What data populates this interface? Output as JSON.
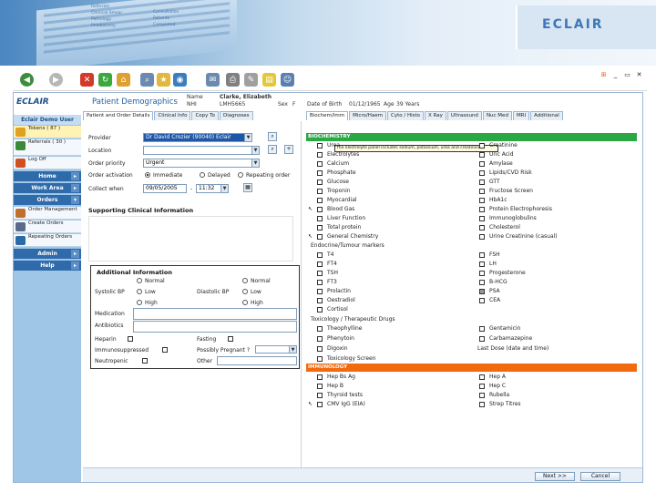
{
  "banner": {
    "brand": "ECLAIR",
    "bg_text": [
      "Referrals",
      "Cervical Smear",
      "Pathology",
      "Phlebotomy",
      "Consultation",
      "Patients",
      "Completed"
    ],
    "accent": "#3f78b6"
  },
  "app": {
    "logo": "ECLAIR",
    "user": "Eclair Demo User"
  },
  "sidebar": {
    "items": [
      {
        "label": "Tokens ( 87 )",
        "icon": "tokens-icon"
      },
      {
        "label": "Referrals ( 30 )",
        "icon": "referrals-icon"
      },
      {
        "label": "Log Off",
        "icon": "log-off-icon"
      }
    ],
    "sections": [
      {
        "label": "Home"
      },
      {
        "label": "Work Area"
      },
      {
        "label": "Orders"
      }
    ],
    "order_items": [
      {
        "label": "Order Management",
        "icon": "order-management-icon"
      },
      {
        "label": "Create Orders",
        "icon": "create-orders-icon"
      },
      {
        "label": "Repeating Orders",
        "icon": "repeating-orders-icon"
      }
    ],
    "bottom_sections": [
      {
        "label": "Admin"
      },
      {
        "label": "Help"
      }
    ]
  },
  "header": {
    "title": "Patient Demographics",
    "name_label": "Name",
    "name_value": "Clarke, Elizabeth",
    "nhi_label": "NHI",
    "nhi_value": "LMH5665",
    "sex_label": "Sex",
    "sex_value": "F",
    "dob_label": "Date of Birth",
    "dob_value": "01/12/1965",
    "age_label": "Age",
    "age_value": "39 Years"
  },
  "left_tabs": [
    "Patient and Order Details",
    "Clinical Info",
    "Copy To",
    "Diagnoses"
  ],
  "form": {
    "provider_label": "Provider",
    "provider_value": "Dr David Crozier (90040) Eclair",
    "location_label": "Location",
    "location_value": "",
    "priority_label": "Order priority",
    "priority_value": "Urgent",
    "activation_label": "Order activation",
    "activation_options": [
      "Immediate",
      "Delayed",
      "Repeating order"
    ],
    "collect_label": "Collect when",
    "collect_date": "09/05/2005",
    "collect_time": "11:32",
    "supporting_label": "Supporting Clinical Information",
    "additional_label": "Additional Information",
    "systolic_label": "Systolic BP",
    "diastolic_label": "Diastolic BP",
    "bp_options": [
      "Normal",
      "Low",
      "High"
    ],
    "medication_label": "Medication",
    "antibiotics_label": "Antibiotics",
    "heparin_label": "Heparin",
    "fasting_label": "Fasting",
    "immuno_label": "Immunosuppressed",
    "pregnant_label": "Possibly Pregnant ?",
    "neutropenic_label": "Neutropenic",
    "other_label": "Other"
  },
  "right_tabs": [
    "Biochem/Imm",
    "Micro/Haem",
    "Cyto / Histo",
    "X Ray",
    "Ultrasound",
    "Nuc Med",
    "MRI",
    "Additional"
  ],
  "biochem": {
    "header": "BIOCHEMISTRY",
    "tooltip": "The electrolyte panel includes sodium, potassium, urea and creatinine.",
    "left": [
      "Urea",
      "Electrolytes",
      "Calcium",
      "Phosphate",
      "Glucose",
      "Troponin",
      "Myocardial",
      "Blood Gas",
      "Liver Function",
      "Total protein",
      "General Chemistry"
    ],
    "right": [
      "Creatinine",
      "Uric Acid",
      "Amylase",
      "Lipids/CVD Risk",
      "GTT",
      "Fructose Screen",
      "HbA1c",
      "Protein Electrophoresis",
      "Immunoglobulins",
      "Cholesterol",
      "Urine Creatinine (casual)"
    ],
    "endocrine_label": "Endocrine/Tumour markers",
    "endo_left": [
      "T4",
      "FT4",
      "TSH",
      "FT3",
      "Prolactin",
      "Oestradiol",
      "Cortisol"
    ],
    "endo_right": [
      "FSH",
      "LH",
      "Progesterone",
      "B-HCG",
      "PSA",
      "CEA"
    ],
    "tox_label": "Toxicology / Therapeutic Drugs",
    "tox_left": [
      "Theophylline",
      "Phenytoin",
      "Digoxin",
      "Toxicology Screen"
    ],
    "tox_right": [
      "Gentamicin",
      "Carbamazepine"
    ],
    "last_dose_label": "Last Dose (date and time)"
  },
  "immunology": {
    "header": "IMMUNOLOGY",
    "left": [
      "Hep Bs Ag",
      "Hep B",
      "Thyroid tests",
      "CMV IgG (EIA)"
    ],
    "right": [
      "Hep A",
      "Hep C",
      "Rubella",
      "Strep Titres"
    ]
  },
  "footer": {
    "next_label": "Next >>",
    "cancel_label": "Cancel"
  }
}
